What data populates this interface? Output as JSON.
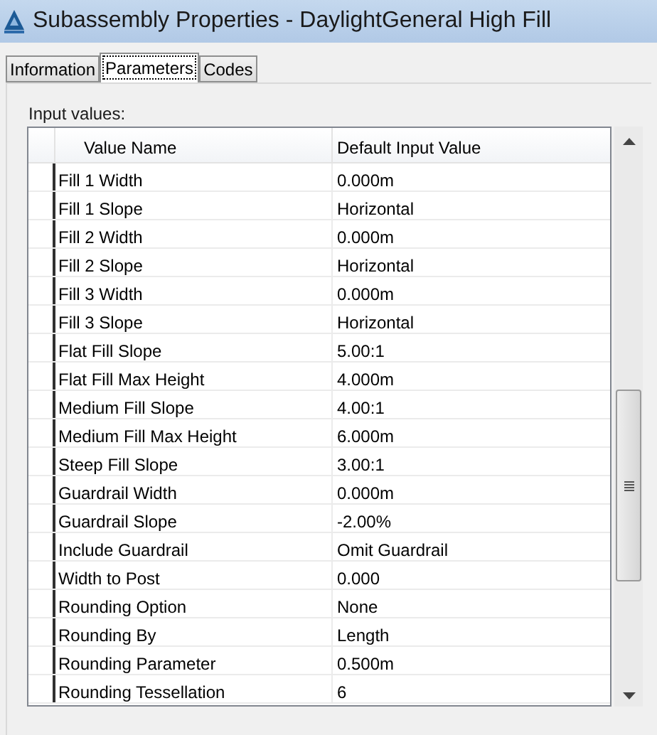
{
  "window": {
    "title": "Subassembly Properties - DaylightGeneral High Fill"
  },
  "tabs": [
    {
      "label": "Information",
      "selected": false
    },
    {
      "label": "Parameters",
      "selected": true
    },
    {
      "label": "Codes",
      "selected": false
    }
  ],
  "section_label": "Input values:",
  "table": {
    "columns": [
      "Value Name",
      "Default Input Value"
    ],
    "rows": [
      [
        "Fill 1 Width",
        "0.000m"
      ],
      [
        "Fill 1 Slope",
        "Horizontal"
      ],
      [
        "Fill 2 Width",
        "0.000m"
      ],
      [
        "Fill 2 Slope",
        "Horizontal"
      ],
      [
        "Fill 3 Width",
        "0.000m"
      ],
      [
        "Fill 3 Slope",
        "Horizontal"
      ],
      [
        "Flat Fill Slope",
        "5.00:1"
      ],
      [
        "Flat Fill Max Height",
        "4.000m"
      ],
      [
        "Medium Fill Slope",
        "4.00:1"
      ],
      [
        "Medium Fill Max Height",
        "6.000m"
      ],
      [
        "Steep Fill Slope",
        "3.00:1"
      ],
      [
        "Guardrail Width",
        "0.000m"
      ],
      [
        "Guardrail Slope",
        "-2.00%"
      ],
      [
        "Include Guardrail",
        "Omit Guardrail"
      ],
      [
        "Width to Post",
        "0.000"
      ],
      [
        "Rounding Option",
        "None"
      ],
      [
        "Rounding By",
        "Length"
      ],
      [
        "Rounding Parameter",
        "0.500m"
      ],
      [
        "Rounding Tessellation",
        "6"
      ]
    ]
  }
}
